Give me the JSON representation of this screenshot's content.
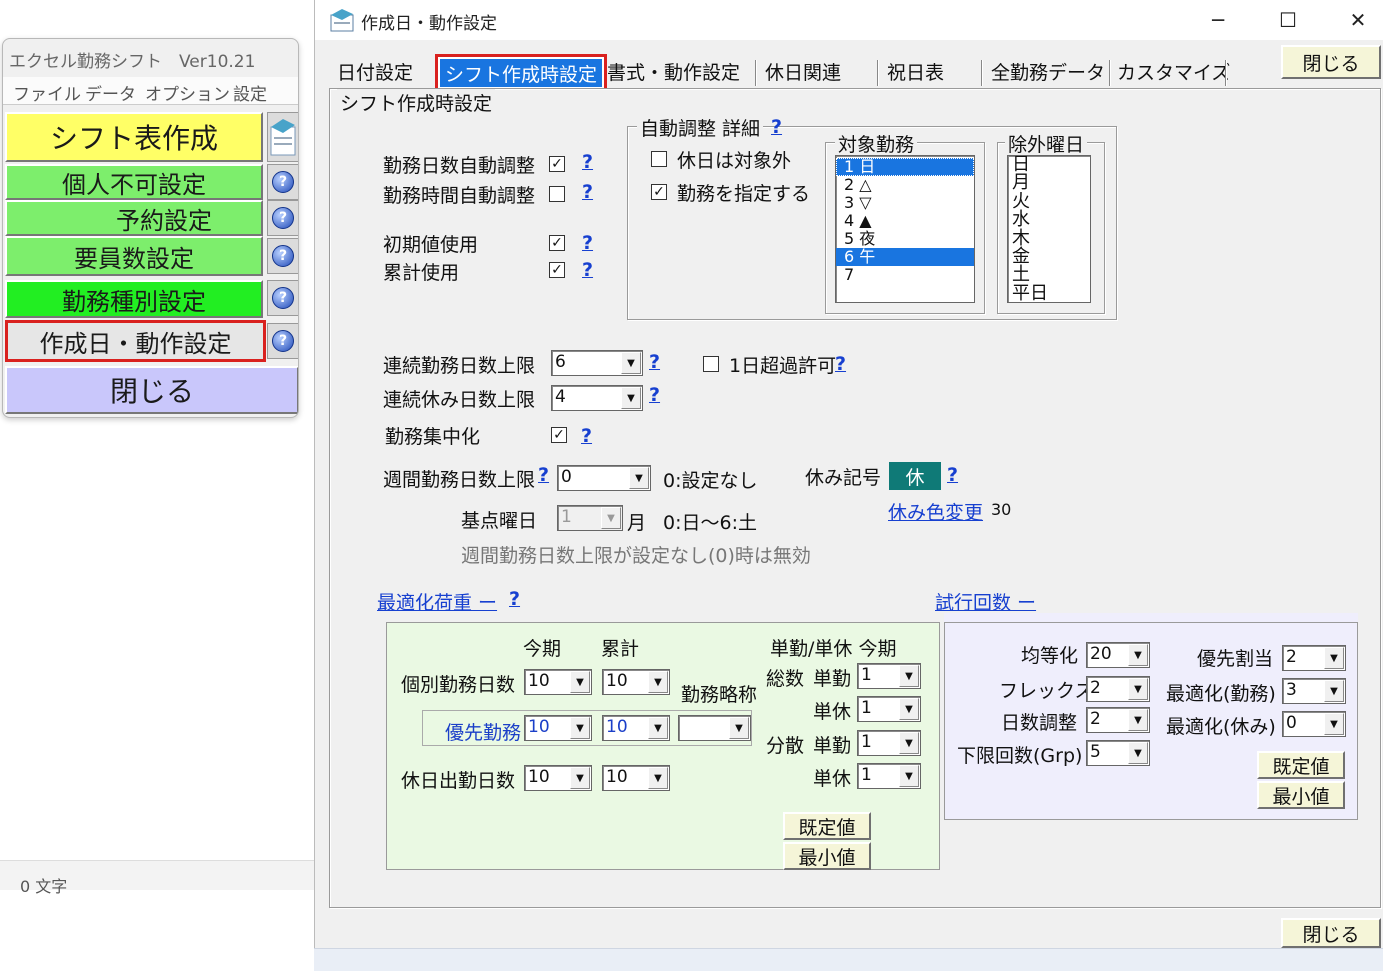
{
  "left_window": {
    "title": "エクセル勤務シフト　Ver10.21",
    "menu": [
      "ファイル",
      "データ",
      "オプション",
      "設定"
    ],
    "buttons": {
      "shift_create": "シフト表作成",
      "personal_ng": "個人不可設定",
      "reservation": "予約設定",
      "staff_count": "要員数設定",
      "duty_type": "勤務種別設定",
      "date_setting": "作成日・動作設定",
      "close": "閉じる"
    },
    "help_icon": "?",
    "colors": {
      "yellow": "#ffff66",
      "green": "#7dee6c",
      "bright_green": "#22ee22",
      "lavender": "#c9c7fb",
      "highlight": "#d9211f"
    }
  },
  "status_bar": {
    "char_count": "0 文字"
  },
  "dialog": {
    "title": "作成日・動作設定",
    "window_controls": {
      "minimize": "─",
      "maximize": "☐",
      "close": "✕"
    },
    "tabs": [
      "日付設定",
      "シフト作成時設定",
      "書式・動作設定",
      "休日関連",
      "祝日表",
      "全勤務データ",
      "カスタマイズ"
    ],
    "active_tab": "シフト作成時設定",
    "close_button": "閉じる",
    "section_title": "シフト作成時設定",
    "help": "?",
    "settings": {
      "workday_auto": {
        "label": "勤務日数自動調整",
        "checked": true
      },
      "worktime_auto": {
        "label": "勤務時間自動調整",
        "checked": false
      },
      "initial_value": {
        "label": "初期値使用",
        "checked": true
      },
      "cumulative": {
        "label": "累計使用",
        "checked": true
      }
    },
    "auto_detail": {
      "title": "自動調整 詳細",
      "holiday_excluded": {
        "label": "休日は対象外",
        "checked": false
      },
      "specify_duty": {
        "label": "勤務を指定する",
        "checked": true
      },
      "target_duty": {
        "title": "対象勤務",
        "items": [
          "1 日",
          "2 △",
          "3 ▽",
          "4 ▲",
          "5 夜",
          "6 午",
          "7"
        ],
        "selected": [
          "1 日",
          "6 午"
        ]
      },
      "exclude_weekday": {
        "title": "除外曜日",
        "items": [
          "日",
          "月",
          "火",
          "水",
          "木",
          "金",
          "土",
          "平日"
        ]
      }
    },
    "consecutive_work": {
      "label": "連続勤務日数上限",
      "value": "6"
    },
    "over_one_day": {
      "label": "1日超過許可",
      "checked": false
    },
    "consecutive_rest": {
      "label": "連続休み日数上限",
      "value": "4"
    },
    "concentration": {
      "label": "勤務集中化",
      "checked": true
    },
    "weekly_limit": {
      "label": "週間勤務日数上限",
      "value": "0",
      "hint": "0:設定なし"
    },
    "rest_symbol": {
      "label": "休み記号",
      "value": "休",
      "color": "#0f7a77"
    },
    "rest_color_change": {
      "label": "休み色変更",
      "value": "30"
    },
    "base_weekday": {
      "label": "基点曜日",
      "value": "1",
      "day": "月",
      "hint": "0:日〜6:土"
    },
    "weekly_note": "週間勤務日数上限が設定なし(0)時は無効",
    "optimization_link": "最適化荷重 ー",
    "trial_link": "試行回数 ー",
    "weights": {
      "col_current": "今期",
      "col_cumulative": "累計",
      "col_single_current": "単勤/単休 今期",
      "individual": {
        "label": "個別勤務日数",
        "current": "10",
        "cumulative": "10"
      },
      "abbr_label": "勤務略称",
      "priority": {
        "label": "優先勤務",
        "current": "10",
        "cumulative": "10",
        "abbr": ""
      },
      "holiday_work": {
        "label": "休日出勤日数",
        "current": "10",
        "cumulative": "10"
      },
      "total_label": "総数",
      "dispersion_label": "分散",
      "single_work_label": "単勤",
      "single_rest_label": "単休",
      "total_single_work": "1",
      "total_single_rest": "1",
      "disp_single_work": "1",
      "disp_single_rest": "1",
      "default_button": "既定値",
      "min_button": "最小値"
    },
    "trials": {
      "equalize": {
        "label": "均等化",
        "value": "20"
      },
      "flex": {
        "label": "フレックス",
        "value": "2"
      },
      "day_adjust": {
        "label": "日数調整",
        "value": "2"
      },
      "min_count": {
        "label": "下限回数(Grp)",
        "value": "5"
      },
      "priority_assign": {
        "label": "優先割当",
        "value": "2"
      },
      "opt_work": {
        "label": "最適化(勤務)",
        "value": "3"
      },
      "opt_rest": {
        "label": "最適化(休み)",
        "value": "0"
      },
      "default_button": "既定値",
      "min_button": "最小値"
    }
  }
}
